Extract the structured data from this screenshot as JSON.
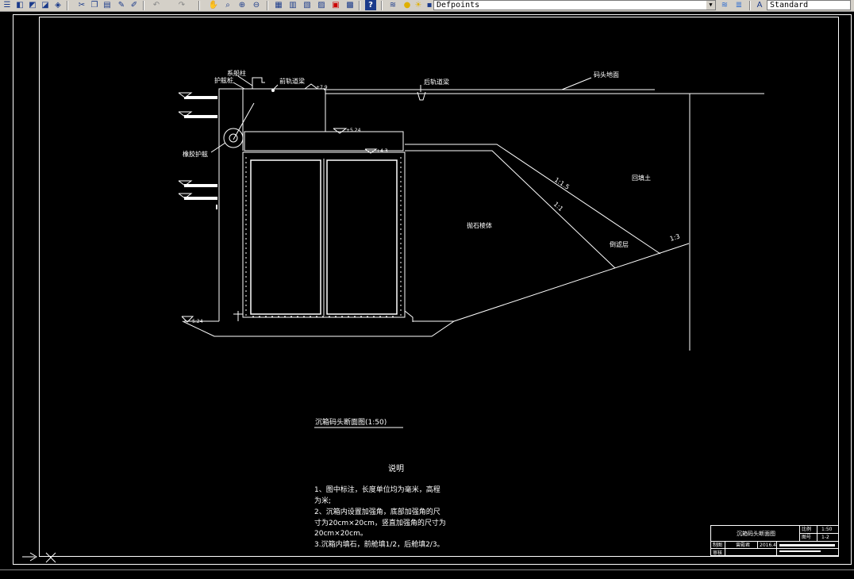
{
  "toolbar": {
    "layer_name": "Defpoints",
    "text_style": "Standard"
  },
  "drawing": {
    "label_mooring_post": "系船柱",
    "label_fender_pile": "护舷桩",
    "label_front_rail": "前轨道梁",
    "label_rear_rail": "后轨道梁",
    "label_wharf_ground": "码头地面",
    "label_rubber_fender": "橡胶护舷",
    "label_backfill": "回填土",
    "label_rockfill": "抛石棱体",
    "label_filter": "倒滤层",
    "slope_1": "1:1.5",
    "slope_2": "1:1",
    "slope_3": "1:3",
    "elev_top": "+7.9",
    "elev_2": "+5.24",
    "elev_3": "+4.3",
    "elev_bottom": "-5.24",
    "section_title": "沉箱码头断面图(1:50)"
  },
  "notes": {
    "heading": "说明",
    "line1": "1、图中标注，长度单位均为毫米，高程",
    "line2": "为米;",
    "line3": "2、沉箱内设置加强角，底部加强角的尺",
    "line4": "寸为20cm×20cm，竖直加强角的尺寸为",
    "line5": "20cm×20cm。",
    "line6": "3.沉箱内填石，前舱填1/2，后舱填2/3。"
  },
  "title_block": {
    "title": "沉箱码头断面图",
    "scale_label": "比例",
    "scale_value": "1:50",
    "sheet_label": "图号",
    "sheet_value": "1-2",
    "drawn_label": "制图",
    "drawn_value": "曾殿君",
    "date_value": "2016.4",
    "check_label": "审核"
  }
}
